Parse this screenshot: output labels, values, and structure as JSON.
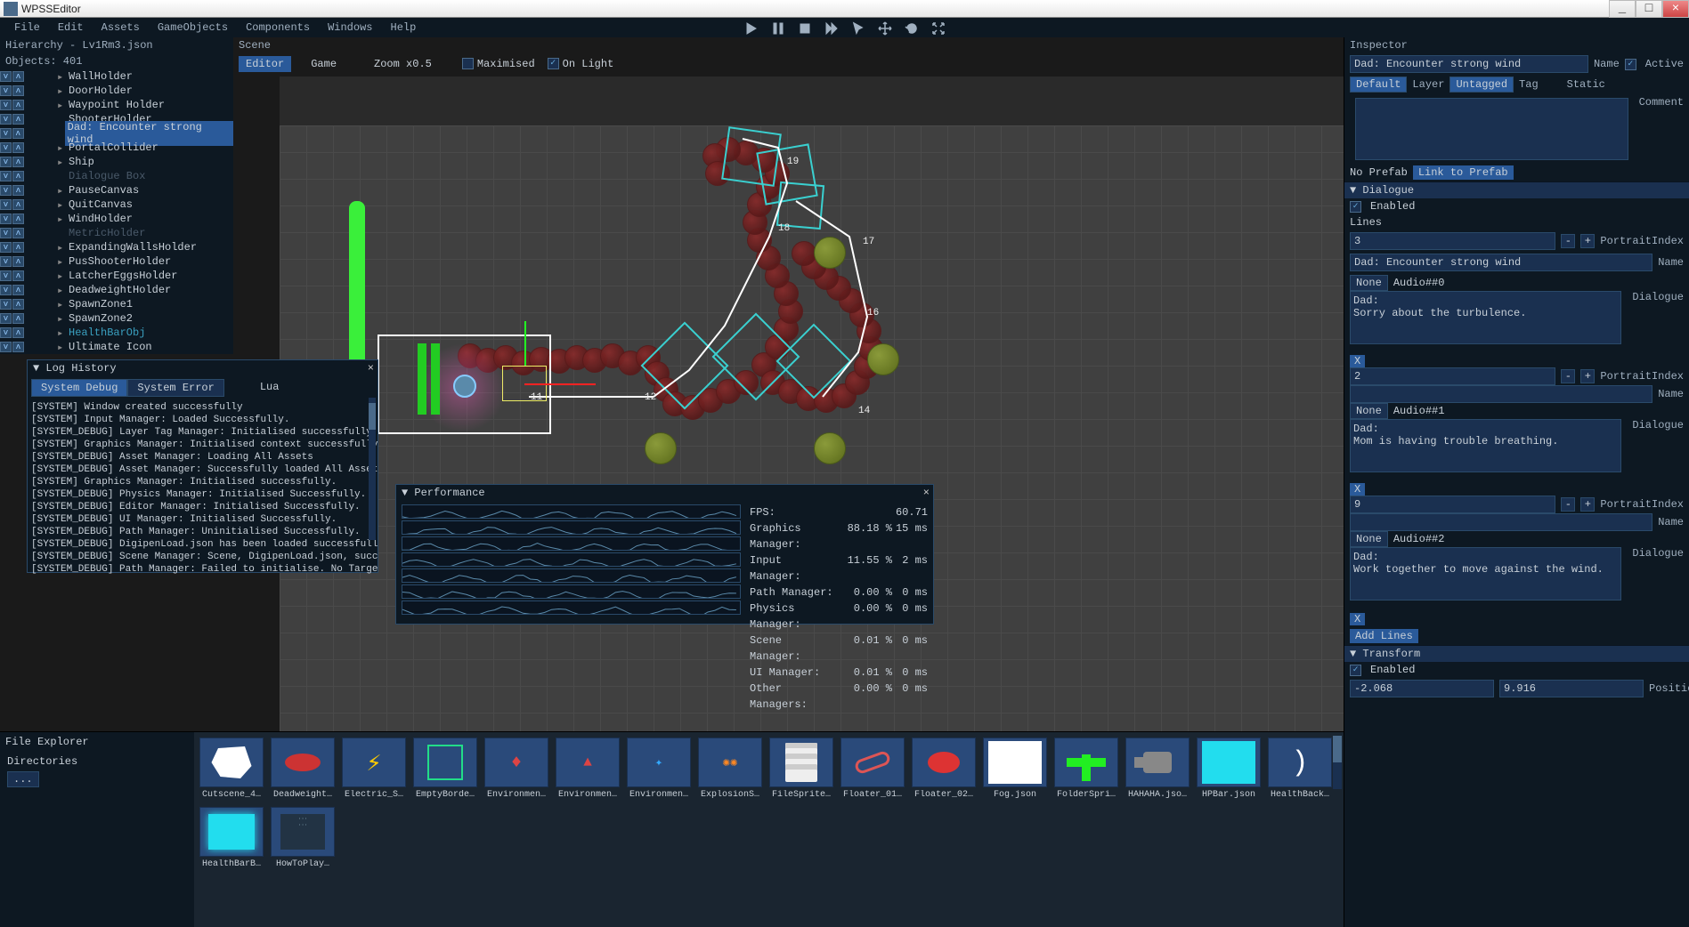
{
  "app": {
    "title": "WPSSEditor"
  },
  "menu": [
    "File",
    "Edit",
    "Assets",
    "GameObjects",
    "Components",
    "Windows",
    "Help"
  ],
  "win_buttons": {
    "min": "_",
    "max": "□",
    "close": "×"
  },
  "hierarchy": {
    "title": "Hierarchy - Lv1Rm3.json",
    "count_label": "Objects: 401",
    "items": [
      {
        "label": "WallHolder",
        "arrow": true
      },
      {
        "label": "DoorHolder",
        "arrow": true
      },
      {
        "label": "Waypoint Holder",
        "arrow": true
      },
      {
        "label": "ShooterHolder"
      },
      {
        "label": "Dad: Encounter strong wind",
        "selected": true
      },
      {
        "label": "PortalCollider",
        "arrow": true
      },
      {
        "label": "Ship",
        "arrow": true
      },
      {
        "label": "Dialogue Box",
        "muted": true
      },
      {
        "label": "PauseCanvas",
        "arrow": true
      },
      {
        "label": "QuitCanvas",
        "arrow": true
      },
      {
        "label": "WindHolder",
        "arrow": true
      },
      {
        "label": "MetricHolder",
        "muted": true
      },
      {
        "label": "ExpandingWallsHolder",
        "arrow": true
      },
      {
        "label": "PusShooterHolder",
        "arrow": true
      },
      {
        "label": "LatcherEggsHolder",
        "arrow": true
      },
      {
        "label": "DeadweightHolder",
        "arrow": true
      },
      {
        "label": "SpawnZone1",
        "arrow": true
      },
      {
        "label": "SpawnZone2",
        "arrow": true
      },
      {
        "label": "HealthBarObj",
        "arrow": true,
        "accent": true
      },
      {
        "label": "Ultimate Icon",
        "arrow": true
      }
    ]
  },
  "scene": {
    "header": "Scene",
    "tab_editor": "Editor",
    "tab_game": "Game",
    "zoom": "Zoom x0.5",
    "maximised": "Maximised",
    "on_light": "On Light",
    "waypoints": [
      "19",
      "18",
      "17",
      "16",
      "14",
      "12",
      "11"
    ]
  },
  "log": {
    "title": "Log History",
    "tabs": [
      "System Debug",
      "System Error",
      "Lua"
    ],
    "lines": [
      "[SYSTEM] Window created successfully",
      "[SYSTEM] Input Manager: Loaded Successfully.",
      "[SYSTEM_DEBUG] Layer Tag Manager: Initialised successfully.",
      "[SYSTEM] Graphics Manager: Initialised context successfully.",
      "[SYSTEM_DEBUG] Asset Manager: Loading All Assets",
      "[SYSTEM_DEBUG] Asset Manager: Successfully loaded All Assets",
      "[SYSTEM] Graphics Manager: Initialised successfully.",
      "[SYSTEM_DEBUG] Physics Manager: Initialised Successfully.",
      "[SYSTEM_DEBUG] Editor Manager: Initialised Successfully.",
      "[SYSTEM_DEBUG] UI Manager: Initialised Successfully.",
      "[SYSTEM_DEBUG] Path Manager: Uninitialised Successfully.",
      "[SYSTEM_DEBUG] DigipenLoad.json has been loaded successfully.",
      "[SYSTEM_DEBUG] Scene Manager: Scene, DigipenLoad.json, successfully",
      "[SYSTEM_DEBUG] Path Manager: Failed to initialise. No Target found."
    ]
  },
  "perf": {
    "title": "Performance",
    "fps_label": "FPS:",
    "fps": "60.71",
    "rows": [
      {
        "k": "Graphics Manager:",
        "p": "88.18 %",
        "t": "15 ms"
      },
      {
        "k": "Input Manager:",
        "p": "11.55 %",
        "t": "2 ms"
      },
      {
        "k": "Path Manager:",
        "p": "0.00 %",
        "t": "0 ms"
      },
      {
        "k": "Physics Manager:",
        "p": "0.00 %",
        "t": "0 ms"
      },
      {
        "k": "Scene Manager:",
        "p": "0.01 %",
        "t": "0 ms"
      },
      {
        "k": "UI Manager:",
        "p": "0.01 %",
        "t": "0 ms"
      },
      {
        "k": "Other Managers:",
        "p": "0.00 %",
        "t": "0 ms"
      }
    ]
  },
  "file_explorer": {
    "title": "File Explorer",
    "dir_label": "Directories",
    "dir_up": "...",
    "assets_row1": [
      {
        "label": "Cutscene_4…",
        "art": "white-blob"
      },
      {
        "label": "Deadweight…",
        "art": "red-blob"
      },
      {
        "label": "Electric_S…",
        "art": "lightning"
      },
      {
        "label": "EmptyBorde…",
        "art": "border"
      },
      {
        "label": "Environmen…",
        "art": "env1"
      },
      {
        "label": "Environmen…",
        "art": "env2"
      },
      {
        "label": "Environmen…",
        "art": "env3"
      },
      {
        "label": "ExplosionS…",
        "art": "explosion"
      },
      {
        "label": "FileSprite…",
        "art": "doc"
      }
    ],
    "assets_row2": [
      {
        "label": "Floater_01…",
        "art": "worm"
      },
      {
        "label": "Floater_02…",
        "art": "worm2"
      },
      {
        "label": "Fog.json",
        "art": "white"
      },
      {
        "label": "FolderSpri…",
        "art": "green-t"
      },
      {
        "label": "HAHAHA.jso…",
        "art": "camera"
      },
      {
        "label": "HPBar.json",
        "art": "cyan"
      },
      {
        "label": "HealthBack…",
        "art": "moon"
      },
      {
        "label": "HealthBarB…",
        "art": "cyan2"
      },
      {
        "label": "HowToPlay…",
        "art": "howto"
      }
    ]
  },
  "inspector": {
    "title": "Inspector",
    "name_field": "Dad: Encounter strong wind",
    "name_label": "Name",
    "active_label": "Active",
    "default": "Default",
    "layer": "Layer",
    "untagged": "Untagged",
    "tag": "Tag",
    "static": "Static",
    "comment_label": "Comment",
    "no_prefab": "No Prefab",
    "link_prefab": "Link to Prefab",
    "dialogue_header": "Dialogue",
    "enabled_label": "Enabled",
    "lines_label": "Lines",
    "lines_count": "3",
    "portrait_label": "PortraitIndex",
    "entry_title": "Dad: Encounter strong wind",
    "entry_title_label": "Name",
    "none": "None",
    "dialogue_label": "Dialogue",
    "entries": [
      {
        "audio": "Audio##0",
        "pi": "",
        "text": "Dad:\nSorry about the turbulence."
      },
      {
        "audio": "Audio##1",
        "pi": "2",
        "text": "Dad:\nMom is having trouble breathing."
      },
      {
        "audio": "Audio##2",
        "pi": "9",
        "text": "Dad:\nWork together to move against the wind."
      }
    ],
    "add_lines": "Add Lines",
    "transform_header": "Transform",
    "pos_label": "Position",
    "pos_x": "-2.068",
    "pos_y": "9.916"
  }
}
